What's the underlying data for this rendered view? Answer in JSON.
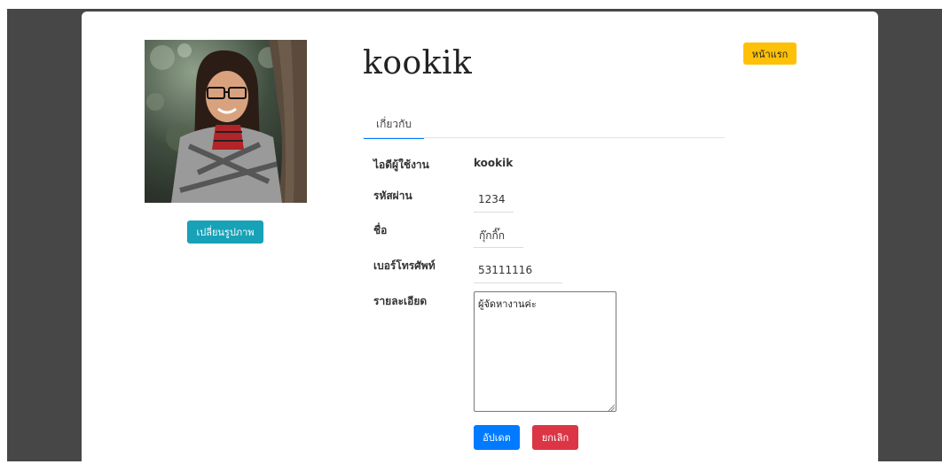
{
  "header": {
    "home_button": "หน้าแรก"
  },
  "profile": {
    "username_title": "kookik",
    "change_photo_button": "เปลี่ยนรูปภาพ"
  },
  "tabs": [
    {
      "label": "เกี่ยวกับ",
      "active": true
    }
  ],
  "fields": {
    "user_id": {
      "label": "ไอดีผู้ใช้งาน",
      "value": "kookik"
    },
    "password": {
      "label": "รหัสผ่าน",
      "value": "1234"
    },
    "name": {
      "label": "ชื่อ",
      "value": "กุ๊กกิ๊ก"
    },
    "phone": {
      "label": "เบอร์โทรศัพท์",
      "value": "53111116"
    },
    "details": {
      "label": "รายละเอียด",
      "value": "ผู้จัดหางานค่ะ"
    }
  },
  "actions": {
    "update_button": "อัปเดต",
    "cancel_button": "ยกเลิก"
  },
  "colors": {
    "info": "#17a2b8",
    "warning": "#ffc107",
    "primary": "#007bff",
    "danger": "#dc3545",
    "backdrop": "#474747"
  }
}
